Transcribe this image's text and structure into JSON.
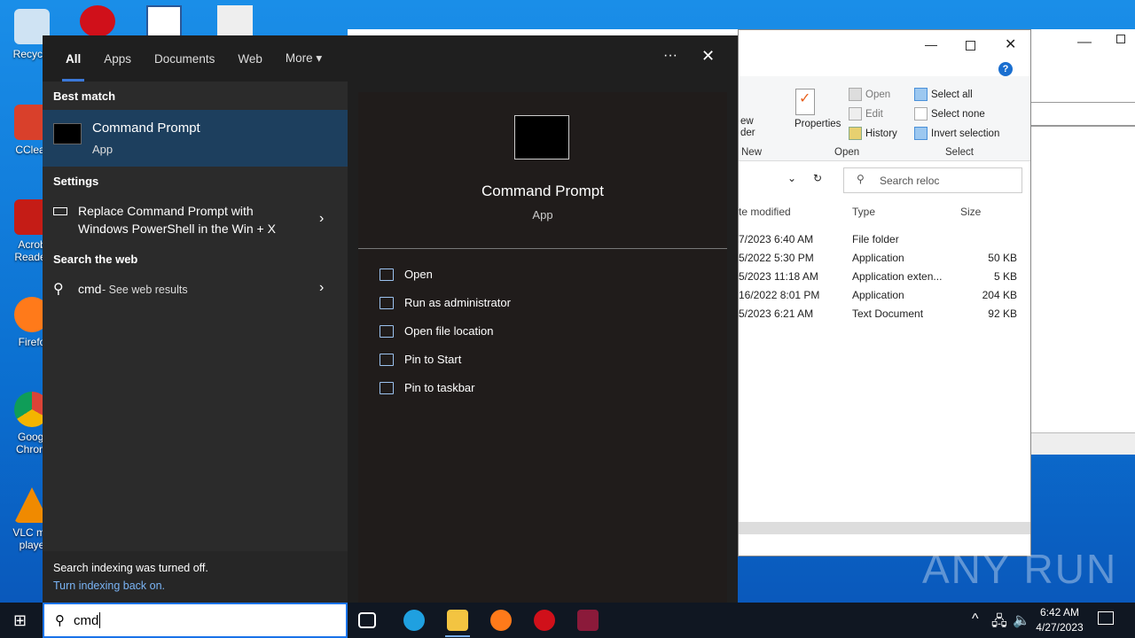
{
  "desktop": {
    "icons": [
      "Recycle",
      "CClear",
      "Acrob Reader",
      "Firefo",
      "Googl Chrom",
      "VLC me playe"
    ]
  },
  "explorer": {
    "ribbon": {
      "new_partial": "ew\nder",
      "properties": "Properties",
      "open": "Open",
      "edit": "Edit",
      "history": "History",
      "select_all": "Select all",
      "select_none": "Select none",
      "invert_selection": "Invert selection",
      "groups": {
        "new": "New",
        "open": "Open",
        "select": "Select"
      }
    },
    "search_placeholder": "Search reloc",
    "columns": {
      "date": "te modified",
      "type": "Type",
      "size": "Size"
    },
    "rows": [
      {
        "date": "7/2023 6:40 AM",
        "type": "File folder",
        "size": ""
      },
      {
        "date": "5/2022 5:30 PM",
        "type": "Application",
        "size": "50 KB"
      },
      {
        "date": "5/2023 11:18 AM",
        "type": "Application exten...",
        "size": "5 KB"
      },
      {
        "date": "16/2022 8:01 PM",
        "type": "Application",
        "size": "204 KB"
      },
      {
        "date": "5/2023 6:21 AM",
        "type": "Text Document",
        "size": "92 KB"
      }
    ]
  },
  "start": {
    "tabs": [
      "All",
      "Apps",
      "Documents",
      "Web",
      "More"
    ],
    "best_match_header": "Best match",
    "best_match": {
      "title": "Command Prompt",
      "subtitle": "App"
    },
    "settings_header": "Settings",
    "settings_item": {
      "line1": "Replace Command Prompt with",
      "line2": "Windows PowerShell in the Win + X"
    },
    "web_header": "Search the web",
    "web_item": {
      "query": "cmd",
      "suffix": " - See web results"
    },
    "footer": {
      "text": "Search indexing was turned off.",
      "link": "Turn indexing back on."
    },
    "preview": {
      "title": "Command Prompt",
      "subtitle": "App"
    },
    "actions": [
      "Open",
      "Run as administrator",
      "Open file location",
      "Pin to Start",
      "Pin to taskbar"
    ]
  },
  "taskbar": {
    "search_value": "cmd",
    "time": "6:42 AM",
    "date": "4/27/2023"
  },
  "watermark": "ANY RUN"
}
